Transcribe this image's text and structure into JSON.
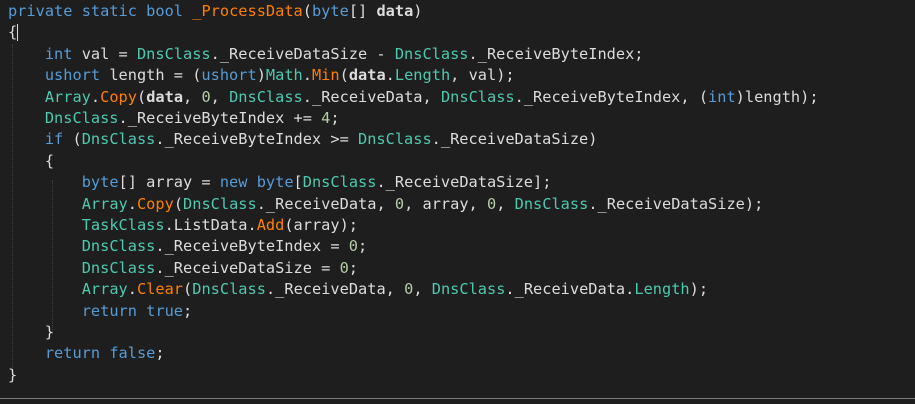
{
  "editor": {
    "colors": {
      "background": "#1e1e1e",
      "keyword": "#569cd6",
      "identifier": "#dcdcdc",
      "type": "#4ec9b0",
      "method": "#ff8000",
      "number": "#b5cea8",
      "parameter": "#9cdcfe"
    },
    "lines": [
      [
        {
          "t": "private",
          "c": "keyword"
        },
        {
          "t": " ",
          "c": "identifier"
        },
        {
          "t": "static",
          "c": "keyword"
        },
        {
          "t": " ",
          "c": "identifier"
        },
        {
          "t": "bool",
          "c": "keyword"
        },
        {
          "t": " ",
          "c": "identifier"
        },
        {
          "t": "_ProcessData",
          "c": "method"
        },
        {
          "t": "(",
          "c": "identifier"
        },
        {
          "t": "byte",
          "c": "keyword"
        },
        {
          "t": "[] ",
          "c": "identifier"
        },
        {
          "t": "data",
          "c": "bold"
        },
        {
          "t": ")",
          "c": "identifier"
        }
      ],
      [
        {
          "t": "{",
          "c": "identifier"
        }
      ],
      [
        {
          "t": "    ",
          "c": "identifier"
        },
        {
          "t": "int",
          "c": "keyword"
        },
        {
          "t": " val = ",
          "c": "identifier"
        },
        {
          "t": "DnsClass",
          "c": "type"
        },
        {
          "t": "._ReceiveDataSize - ",
          "c": "identifier"
        },
        {
          "t": "DnsClass",
          "c": "type"
        },
        {
          "t": "._ReceiveByteIndex;",
          "c": "identifier"
        }
      ],
      [
        {
          "t": "    ",
          "c": "identifier"
        },
        {
          "t": "ushort",
          "c": "keyword"
        },
        {
          "t": " length = (",
          "c": "identifier"
        },
        {
          "t": "ushort",
          "c": "keyword"
        },
        {
          "t": ")",
          "c": "identifier"
        },
        {
          "t": "Math",
          "c": "type"
        },
        {
          "t": ".",
          "c": "identifier"
        },
        {
          "t": "Min",
          "c": "method"
        },
        {
          "t": "(",
          "c": "identifier"
        },
        {
          "t": "data",
          "c": "bold"
        },
        {
          "t": ".",
          "c": "identifier"
        },
        {
          "t": "Length",
          "c": "property"
        },
        {
          "t": ", val);",
          "c": "identifier"
        }
      ],
      [
        {
          "t": "    ",
          "c": "identifier"
        },
        {
          "t": "Array",
          "c": "type"
        },
        {
          "t": ".",
          "c": "identifier"
        },
        {
          "t": "Copy",
          "c": "method"
        },
        {
          "t": "(",
          "c": "identifier"
        },
        {
          "t": "data",
          "c": "bold"
        },
        {
          "t": ", ",
          "c": "identifier"
        },
        {
          "t": "0",
          "c": "number"
        },
        {
          "t": ", ",
          "c": "identifier"
        },
        {
          "t": "DnsClass",
          "c": "type"
        },
        {
          "t": "._ReceiveData, ",
          "c": "identifier"
        },
        {
          "t": "DnsClass",
          "c": "type"
        },
        {
          "t": "._ReceiveByteIndex, (",
          "c": "identifier"
        },
        {
          "t": "int",
          "c": "keyword"
        },
        {
          "t": ")length);",
          "c": "identifier"
        }
      ],
      [
        {
          "t": "    ",
          "c": "identifier"
        },
        {
          "t": "DnsClass",
          "c": "type"
        },
        {
          "t": "._ReceiveByteIndex += ",
          "c": "identifier"
        },
        {
          "t": "4",
          "c": "number"
        },
        {
          "t": ";",
          "c": "identifier"
        }
      ],
      [
        {
          "t": "    ",
          "c": "identifier"
        },
        {
          "t": "if",
          "c": "keyword"
        },
        {
          "t": " (",
          "c": "identifier"
        },
        {
          "t": "DnsClass",
          "c": "type"
        },
        {
          "t": "._ReceiveByteIndex >= ",
          "c": "identifier"
        },
        {
          "t": "DnsClass",
          "c": "type"
        },
        {
          "t": "._ReceiveDataSize)",
          "c": "identifier"
        }
      ],
      [
        {
          "t": "    {",
          "c": "identifier"
        }
      ],
      [
        {
          "t": "        ",
          "c": "identifier"
        },
        {
          "t": "byte",
          "c": "keyword"
        },
        {
          "t": "[] array = ",
          "c": "identifier"
        },
        {
          "t": "new",
          "c": "keyword"
        },
        {
          "t": " ",
          "c": "identifier"
        },
        {
          "t": "byte",
          "c": "keyword"
        },
        {
          "t": "[",
          "c": "identifier"
        },
        {
          "t": "DnsClass",
          "c": "type"
        },
        {
          "t": "._ReceiveDataSize];",
          "c": "identifier"
        }
      ],
      [
        {
          "t": "        ",
          "c": "identifier"
        },
        {
          "t": "Array",
          "c": "type"
        },
        {
          "t": ".",
          "c": "identifier"
        },
        {
          "t": "Copy",
          "c": "method"
        },
        {
          "t": "(",
          "c": "identifier"
        },
        {
          "t": "DnsClass",
          "c": "type"
        },
        {
          "t": "._ReceiveData, ",
          "c": "identifier"
        },
        {
          "t": "0",
          "c": "number"
        },
        {
          "t": ", array, ",
          "c": "identifier"
        },
        {
          "t": "0",
          "c": "number"
        },
        {
          "t": ", ",
          "c": "identifier"
        },
        {
          "t": "DnsClass",
          "c": "type"
        },
        {
          "t": "._ReceiveDataSize);",
          "c": "identifier"
        }
      ],
      [
        {
          "t": "        ",
          "c": "identifier"
        },
        {
          "t": "TaskClass",
          "c": "type"
        },
        {
          "t": ".ListData.",
          "c": "identifier"
        },
        {
          "t": "Add",
          "c": "method"
        },
        {
          "t": "(array);",
          "c": "identifier"
        }
      ],
      [
        {
          "t": "        ",
          "c": "identifier"
        },
        {
          "t": "DnsClass",
          "c": "type"
        },
        {
          "t": "._ReceiveByteIndex = ",
          "c": "identifier"
        },
        {
          "t": "0",
          "c": "number"
        },
        {
          "t": ";",
          "c": "identifier"
        }
      ],
      [
        {
          "t": "        ",
          "c": "identifier"
        },
        {
          "t": "DnsClass",
          "c": "type"
        },
        {
          "t": "._ReceiveDataSize = ",
          "c": "identifier"
        },
        {
          "t": "0",
          "c": "number"
        },
        {
          "t": ";",
          "c": "identifier"
        }
      ],
      [
        {
          "t": "        ",
          "c": "identifier"
        },
        {
          "t": "Array",
          "c": "type"
        },
        {
          "t": ".",
          "c": "identifier"
        },
        {
          "t": "Clear",
          "c": "method"
        },
        {
          "t": "(",
          "c": "identifier"
        },
        {
          "t": "DnsClass",
          "c": "type"
        },
        {
          "t": "._ReceiveData, ",
          "c": "identifier"
        },
        {
          "t": "0",
          "c": "number"
        },
        {
          "t": ", ",
          "c": "identifier"
        },
        {
          "t": "DnsClass",
          "c": "type"
        },
        {
          "t": "._ReceiveData.",
          "c": "identifier"
        },
        {
          "t": "Length",
          "c": "property"
        },
        {
          "t": ");",
          "c": "identifier"
        }
      ],
      [
        {
          "t": "        ",
          "c": "identifier"
        },
        {
          "t": "return",
          "c": "keyword"
        },
        {
          "t": " ",
          "c": "identifier"
        },
        {
          "t": "true",
          "c": "keyword"
        },
        {
          "t": ";",
          "c": "identifier"
        }
      ],
      [
        {
          "t": "    }",
          "c": "identifier"
        }
      ],
      [
        {
          "t": "    ",
          "c": "identifier"
        },
        {
          "t": "return",
          "c": "keyword"
        },
        {
          "t": " ",
          "c": "identifier"
        },
        {
          "t": "false",
          "c": "keyword"
        },
        {
          "t": ";",
          "c": "identifier"
        }
      ],
      [
        {
          "t": "}",
          "c": "identifier"
        }
      ]
    ]
  }
}
